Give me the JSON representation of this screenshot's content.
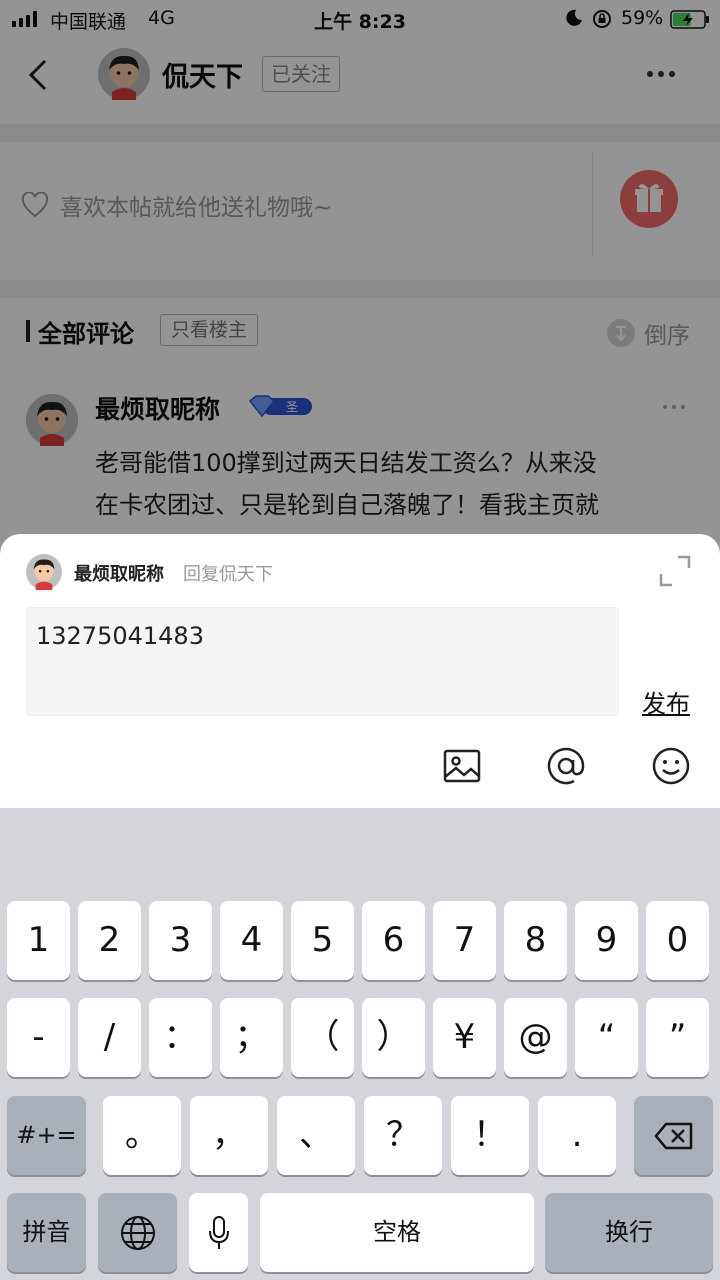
{
  "status_bar": {
    "carrier": "中国联通",
    "network": "4G",
    "time": "上午 8:23",
    "battery_percent": "59%",
    "battery_level": 0.59,
    "battery_charging": true
  },
  "nav_bar": {
    "username": "侃天下",
    "follow_status": "已关注"
  },
  "gift_row": {
    "prompt": "喜欢本帖就给他送礼物哦~"
  },
  "comments_header": {
    "title": "全部评论",
    "only_op_button": "只看楼主",
    "sort_label": "倒序"
  },
  "comment": {
    "author": "最烦取昵称",
    "badge_text": "圣",
    "line1": "老哥能借100撑到过两天日结发工资么？从来没",
    "line2": "在卡农团过、只是轮到自己落魄了！看我主页就"
  },
  "reply_sheet": {
    "author": "最烦取昵称",
    "reply_to": "回复侃天下",
    "input_value": "13275041483",
    "publish_label": "发布"
  },
  "keyboard": {
    "row1": [
      "1",
      "2",
      "3",
      "4",
      "5",
      "6",
      "7",
      "8",
      "9",
      "0"
    ],
    "row2": [
      "-",
      "/",
      "：",
      "；",
      "（",
      "）",
      "¥",
      "@",
      "“",
      "”"
    ],
    "row3_mode": "#+=",
    "row3": [
      "。",
      "，",
      "、",
      "？",
      "！",
      "."
    ],
    "pinyin": "拼音",
    "space": "空格",
    "return": "换行"
  },
  "colors": {
    "gift_button": "#f26b6b",
    "badge": "#2b55d6",
    "keyboard_bg": "#d3d5db",
    "battery_green": "#4cd964"
  }
}
